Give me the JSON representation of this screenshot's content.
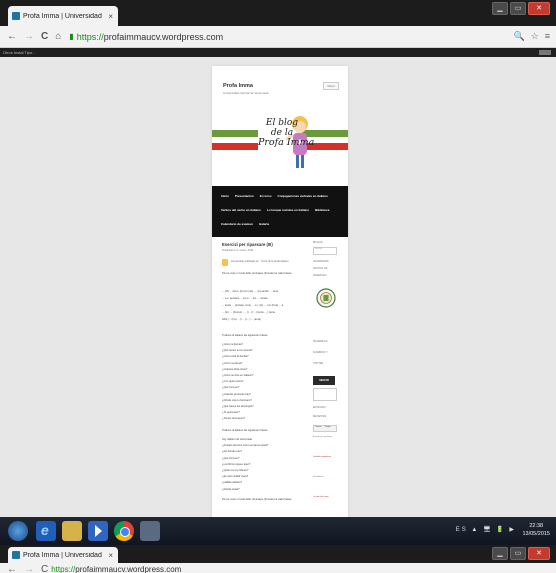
{
  "browser": {
    "tab_title": "Profa Imma | Universidad",
    "tab_close": "×",
    "url_scheme": "https://",
    "url_host": "profaimmaucv.wordpress.com",
    "bookmarks_text": "Otros  Instal  Tipo...",
    "win_min": "▁",
    "win_max": "▭",
    "win_close": "✕",
    "nav_back": "←",
    "nav_forward": "→",
    "nav_reload": "C",
    "nav_home": "⌂",
    "lock": "🔒",
    "tb_right_1": "🔍",
    "tb_right_2": "☆",
    "tb_right_3": "≡"
  },
  "site": {
    "title": "Profa Imma",
    "description": "Universidad Central de Venezuela",
    "menu_button": "Menú",
    "banner_lines": [
      "El blog",
      "de la",
      "Profa Imma"
    ],
    "colors": {
      "green": "#6b9a3a",
      "red": "#d6302a",
      "nav_bg": "#111111",
      "link": "#21759b"
    },
    "nav": {
      "row1": [
        "Inicio",
        "Presentación",
        "El curso",
        "Conjugaciones verbales en italiano"
      ],
      "row2": [
        "Verbos del verbo en italiano",
        "Lo lunque revistas en italiano",
        "Biblioteca"
      ],
      "row3": [
        "Calendario de examen",
        "Galeria"
      ]
    }
  },
  "post": {
    "title": "Esercizi per ripassare (III)",
    "date": "Publicado en 1 marzo, 2015",
    "author_line": "Comentario publicado en · Trozo de la profa Italiano",
    "intro": "Pon la voce o troval delle centraque (formate) le cada frases:",
    "lines": [
      "....(VI) ... devo, (tu) cm (do) .... (tu) andrò .... ama",
      "... e.e. pensare ... Lo io .... sin .... amato",
      "... avete ... (tornate, sono .... e.i. (lo) .... cm (l'ora) ... a",
      "... (lo) .... (ritorno) ..... (l... (l ...) (sono ....) (ama",
      "Abiti (... (l lo) ... (l ... (l ...) ... (ama)"
    ],
    "exercise1_title": "Traduce al italiano las siguientes frases:",
    "exercise1": [
      "¿Cómo te llamas?",
      "¿Qué tienes en la nevera?",
      "¿Cómo está la familia?",
      "¿Cómo se llama?",
      "¿Cuántos años tiene?",
      "¿Cómo se dice en italiano?",
      "¿Con quién vives?",
      "¿Qué hora es?",
      "¿Cuántas personas hay?",
      "¿Dónde vive tu hermano?",
      "¿Qué haces los domingos?",
      "¿Te gusta leer?",
      "¿Tienes hermanos?"
    ],
    "exercise2_title": "Traduce al italiano las siguientes frases:",
    "exercise2": [
      "Soy italiano de Venezuela",
      "¿Puedes decirme cómo se llama usted?",
      "¿De dónde eres?",
      "¿Qué hora es?",
      "¿Los libros siguen aquí?",
      "¿Quién es el profesor?",
      "¿En qué ciudad vives?",
      "¿Hablas italiano?",
      "¿Dónde estás?"
    ],
    "outro": "Pon la voce o troval delle centraque (formate) le cada frases:"
  },
  "sidebar": {
    "search_label": "BUSCAR",
    "search_placeholder": "Buscar",
    "items": [
      "UNIVERSIDAD",
      "CENTRAL DE",
      "VENEZUELA"
    ],
    "section2": [
      "SÍGUEME EN",
      "FACEBOOK Y",
      "TWITTER"
    ],
    "follow_button": "SEGUIR",
    "section3": [
      "ENTRADAS",
      "RECIENTES"
    ],
    "small": [
      "Esercizi per ripassare",
      "Tombola napoletana",
      "Vocabolario",
      "Le parti del corpo"
    ],
    "tiny_tab_1": "Tweets",
    "tiny_tab_2": "Seguir"
  },
  "taskbar": {
    "tray": "ES ▲ 🖥 🔋 ▶",
    "time": "22:38",
    "date": "13/05/2015"
  }
}
